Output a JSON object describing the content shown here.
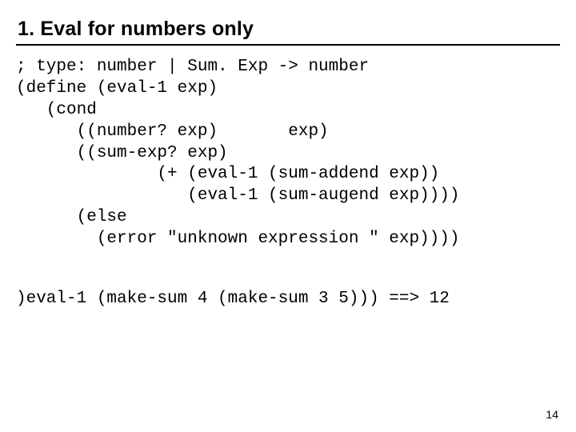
{
  "title": "1. Eval for numbers only",
  "code": {
    "l1": "; type: number | Sum. Exp -> number",
    "l2": "(define (eval-1 exp)",
    "l3": "   (cond",
    "l4": "      ((number? exp)       exp)",
    "l5": "      ((sum-exp? exp)",
    "l6": "              (+ (eval-1 (sum-addend exp))",
    "l7": "                 (eval-1 (sum-augend exp))))",
    "l8": "      (else",
    "l9": "        (error \"unknown expression \" exp))))"
  },
  "example": ")eval-1 (make-sum 4 (make-sum 3 5))) ==> 12",
  "page_number": "14"
}
